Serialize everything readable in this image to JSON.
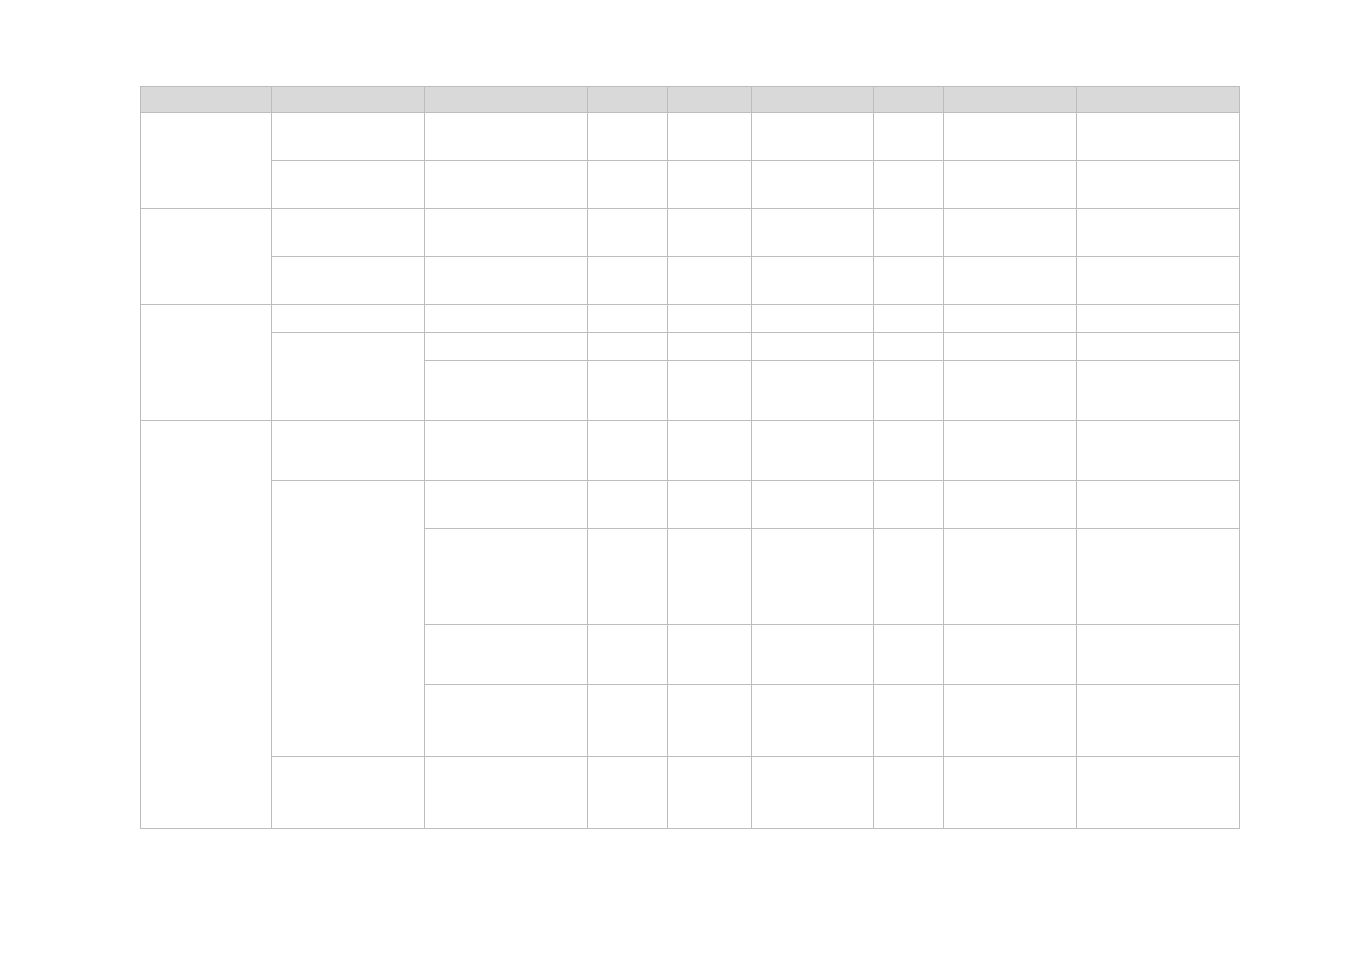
{
  "table": {
    "headers": [
      "",
      "",
      "",
      "",
      "",
      "",
      "",
      "",
      ""
    ],
    "groups": [
      {
        "label": "",
        "rows": [
          {
            "col1": "",
            "cells": [
              "",
              "",
              "",
              "",
              "",
              "",
              ""
            ]
          },
          {
            "col1": "",
            "cells": [
              "",
              "",
              "",
              "",
              "",
              "",
              ""
            ]
          }
        ]
      },
      {
        "label": "",
        "rows": [
          {
            "col1": "",
            "cells": [
              "",
              "",
              "",
              "",
              "",
              "",
              ""
            ]
          },
          {
            "col1": "",
            "cells": [
              "",
              "",
              "",
              "",
              "",
              "",
              ""
            ]
          }
        ]
      },
      {
        "label": "",
        "rows": [
          {
            "col1": "",
            "cells": [
              "",
              "",
              "",
              "",
              "",
              "",
              ""
            ]
          },
          {
            "col1": "",
            "subrows": [
              {
                "cells": [
                  "",
                  "",
                  "",
                  "",
                  "",
                  "",
                  ""
                ]
              },
              {
                "cells": [
                  "",
                  "",
                  "",
                  "",
                  "",
                  "",
                  ""
                ]
              }
            ]
          }
        ]
      },
      {
        "label": "",
        "rows": [
          {
            "col1": "",
            "cells": [
              "",
              "",
              "",
              "",
              "",
              "",
              ""
            ]
          },
          {
            "col1": "",
            "subrows": [
              {
                "cells": [
                  "",
                  "",
                  "",
                  "",
                  "",
                  "",
                  ""
                ]
              },
              {
                "cells": [
                  "",
                  "",
                  "",
                  "",
                  "",
                  "",
                  ""
                ]
              },
              {
                "cells": [
                  "",
                  "",
                  "",
                  "",
                  "",
                  "",
                  ""
                ]
              },
              {
                "cells": [
                  "",
                  "",
                  "",
                  "",
                  "",
                  "",
                  ""
                ]
              }
            ]
          },
          {
            "col1": "",
            "cells": [
              "",
              "",
              "",
              "",
              "",
              "",
              ""
            ]
          }
        ]
      }
    ]
  }
}
